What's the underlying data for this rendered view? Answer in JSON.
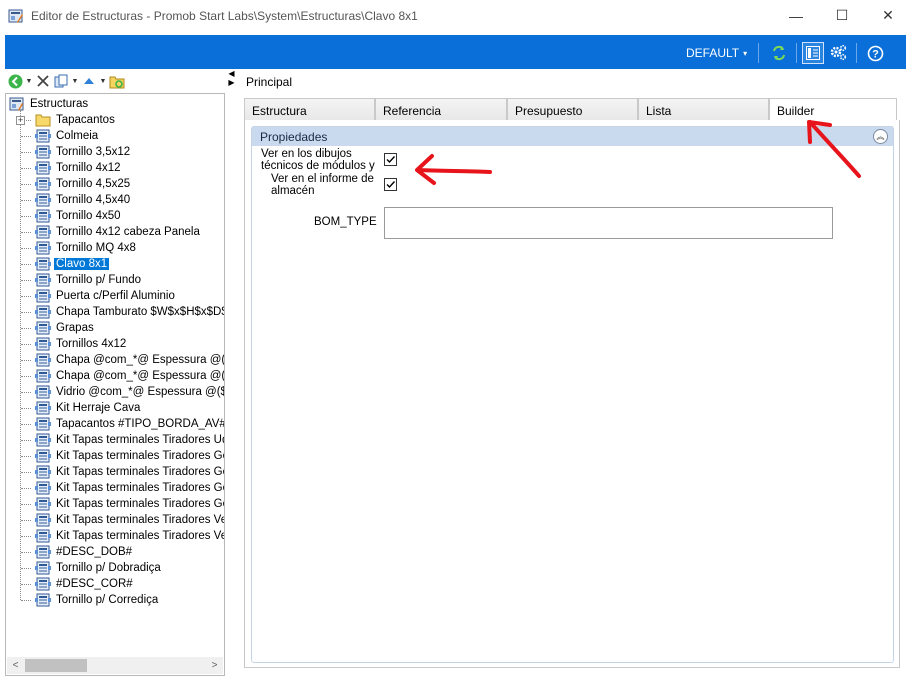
{
  "window": {
    "title": "Editor de Estructuras - Promob Start Labs\\System\\Estructuras\\Clavo 8x1",
    "minimize_glyph": "—",
    "maximize_glyph": "☐",
    "close_glyph": "✕"
  },
  "toolbar": {
    "profile_label": "DEFAULT",
    "profile_caret": "▾",
    "icons": [
      "refresh-icon",
      "layout-icon",
      "settings-gears-icon",
      "help-icon"
    ]
  },
  "tree_toolbar": {
    "icons": [
      "back-icon",
      "delete-icon",
      "copy-icon",
      "move-up-icon",
      "folder-refresh-icon"
    ]
  },
  "splitter": {
    "left_glyph": "◀",
    "right_glyph": "▶"
  },
  "tree": {
    "root": "Estructuras",
    "items": [
      {
        "label": "Tapacantos",
        "type": "folder"
      },
      {
        "label": "Colmeia",
        "type": "structure"
      },
      {
        "label": "Tornillo  3,5x12",
        "type": "structure"
      },
      {
        "label": "Tornillo  4x12",
        "type": "structure"
      },
      {
        "label": "Tornillo  4,5x25",
        "type": "structure"
      },
      {
        "label": "Tornillo  4,5x40",
        "type": "structure"
      },
      {
        "label": "Tornillo  4x50",
        "type": "structure"
      },
      {
        "label": "Tornillo  4x12  cabeza Panela",
        "type": "structure"
      },
      {
        "label": "Tornillo  MQ 4x8",
        "type": "structure"
      },
      {
        "label": "Clavo 8x1",
        "type": "structure",
        "selected": true
      },
      {
        "label": "Tornillo  p/ Fundo",
        "type": "structure"
      },
      {
        "label": "Puerta c/Perfil Aluminio",
        "type": "structure"
      },
      {
        "label": "Chapa Tamburato $W$x$H$x$D$m",
        "type": "structure"
      },
      {
        "label": "Grapas",
        "type": "structure"
      },
      {
        "label": "Tornillos  4x12",
        "type": "structure"
      },
      {
        "label": "Chapa @com_*@ Espessura @($H",
        "type": "structure"
      },
      {
        "label": "Chapa @com_*@ Espessura @($H",
        "type": "structure"
      },
      {
        "label": "Vidrio @com_*@ Espessura @($H",
        "type": "structure"
      },
      {
        "label": "Kit Herraje Cava",
        "type": "structure"
      },
      {
        "label": "Tapacantos #TIPO_BORDA_AV# $",
        "type": "structure"
      },
      {
        "label": "Kit Tapas terminales Tiradores  Ud",
        "type": "structure"
      },
      {
        "label": "Kit Tapas terminales Tiradores  Go",
        "type": "structure"
      },
      {
        "label": "Kit Tapas terminales Tiradores  Go",
        "type": "structure"
      },
      {
        "label": "Kit Tapas terminales Tiradores  Go",
        "type": "structure"
      },
      {
        "label": "Kit Tapas terminales Tiradores  Go",
        "type": "structure"
      },
      {
        "label": "Kit Tapas terminales Tiradores  Ver",
        "type": "structure"
      },
      {
        "label": "Kit Tapas terminales Tiradores Vers",
        "type": "structure"
      },
      {
        "label": "#DESC_DOB#",
        "type": "structure"
      },
      {
        "label": "Tornillo  p/ Dobradiça",
        "type": "structure"
      },
      {
        "label": "#DESC_COR#",
        "type": "structure"
      },
      {
        "label": "Tornillo  p/ Corrediça",
        "type": "structure"
      }
    ],
    "scroll_left_glyph": "<",
    "scroll_right_glyph": ">"
  },
  "main": {
    "section_title": "Principal",
    "tabs": [
      {
        "label": "Estructura",
        "active": false
      },
      {
        "label": "Referencia",
        "active": false
      },
      {
        "label": "Presupuesto",
        "active": false
      },
      {
        "label": "Lista",
        "active": false
      },
      {
        "label": "Builder",
        "active": true
      }
    ],
    "properties": {
      "title": "Propiedades",
      "collapse_glyph": "︽",
      "show_in_drawings_label": "Ver en los dibujos técnicos de módulos y",
      "show_in_drawings_checked": true,
      "show_in_storage_label": "Ver en el informe de almacén",
      "show_in_storage_checked": true,
      "bom_type_label": "BOM_TYPE",
      "bom_type_value": ""
    }
  },
  "colors": {
    "accent_blue": "#0a6fd8",
    "selection_blue": "#0078d7",
    "panel_header": "#c9d9ee",
    "annotation_red": "#e8141b"
  }
}
